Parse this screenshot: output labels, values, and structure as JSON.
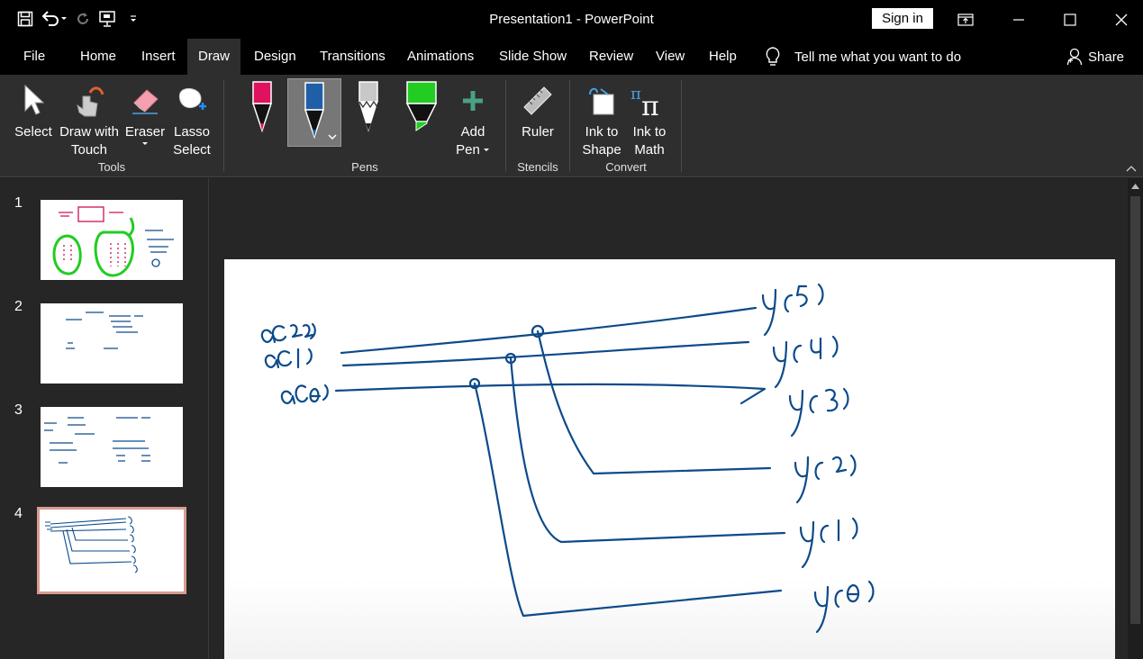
{
  "window": {
    "title": "Presentation1  -  PowerPoint",
    "sign_in": "Sign in"
  },
  "quick_access": [
    "save-icon",
    "undo-icon",
    "redo-icon",
    "present-icon",
    "customize-icon"
  ],
  "tabs": [
    {
      "label": "File"
    },
    {
      "label": "Home"
    },
    {
      "label": "Insert"
    },
    {
      "label": "Draw"
    },
    {
      "label": "Design"
    },
    {
      "label": "Transitions"
    },
    {
      "label": "Animations"
    },
    {
      "label": "Slide Show"
    },
    {
      "label": "Review"
    },
    {
      "label": "View"
    },
    {
      "label": "Help"
    }
  ],
  "active_tab": "Draw",
  "tell_me": "Tell me what you want to do",
  "share": "Share",
  "ribbon": {
    "tools": {
      "select": "Select",
      "draw_with_touch_1": "Draw with",
      "draw_with_touch_2": "Touch",
      "eraser": "Eraser",
      "lasso_1": "Lasso",
      "lasso_2": "Select",
      "group": "Tools"
    },
    "pens": {
      "add_pen_1": "Add",
      "add_pen_2": "Pen",
      "group": "Pens",
      "colors": [
        "#e0115f",
        "#1f5fa8",
        "#d0d0d0",
        "#22cc22"
      ]
    },
    "stencils": {
      "ruler": "Ruler",
      "group": "Stencils"
    },
    "convert": {
      "ink_to_shape_1": "Ink to",
      "ink_to_shape_2": "Shape",
      "ink_to_math_1": "Ink to",
      "ink_to_math_2": "Math",
      "group": "Convert"
    }
  },
  "slides": [
    {
      "number": "1"
    },
    {
      "number": "2"
    },
    {
      "number": "3"
    },
    {
      "number": "4"
    }
  ],
  "selected_slide": "4",
  "colors": {
    "ink": "#0d4a8a",
    "selected_thumb_border": "#d99c91"
  }
}
